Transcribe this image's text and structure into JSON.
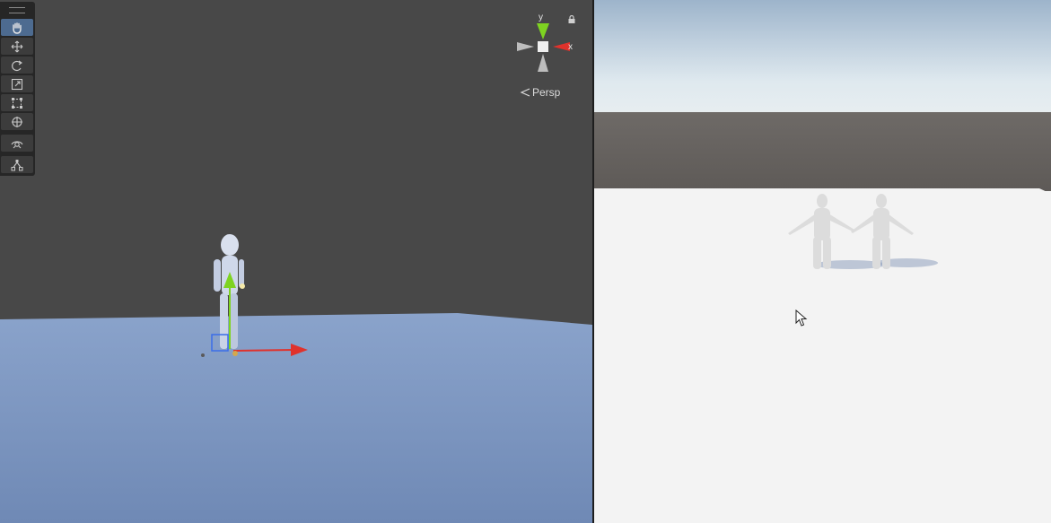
{
  "scene_view": {
    "projection_label": "Persp",
    "gizmo": {
      "y_label": "y",
      "x_label": "x"
    },
    "tools": [
      {
        "name": "hand-tool",
        "active": true
      },
      {
        "name": "move-tool",
        "active": false
      },
      {
        "name": "rotate-tool",
        "active": false
      },
      {
        "name": "scale-tool",
        "active": false
      },
      {
        "name": "rect-tool",
        "active": false
      },
      {
        "name": "transform-tool",
        "active": false
      },
      {
        "name": "view-tool",
        "active": false
      },
      {
        "name": "custom-tool",
        "active": false
      }
    ]
  },
  "colors": {
    "scene_background": "#484848",
    "scene_ground": "#7d97c2",
    "game_sky": "#bfd3e8",
    "game_ground": "#f3f3f3",
    "axis_x": "#e0322c",
    "axis_y": "#7ed321",
    "active_tool": "#4d6b90"
  },
  "game_view": {
    "characters": 2
  }
}
